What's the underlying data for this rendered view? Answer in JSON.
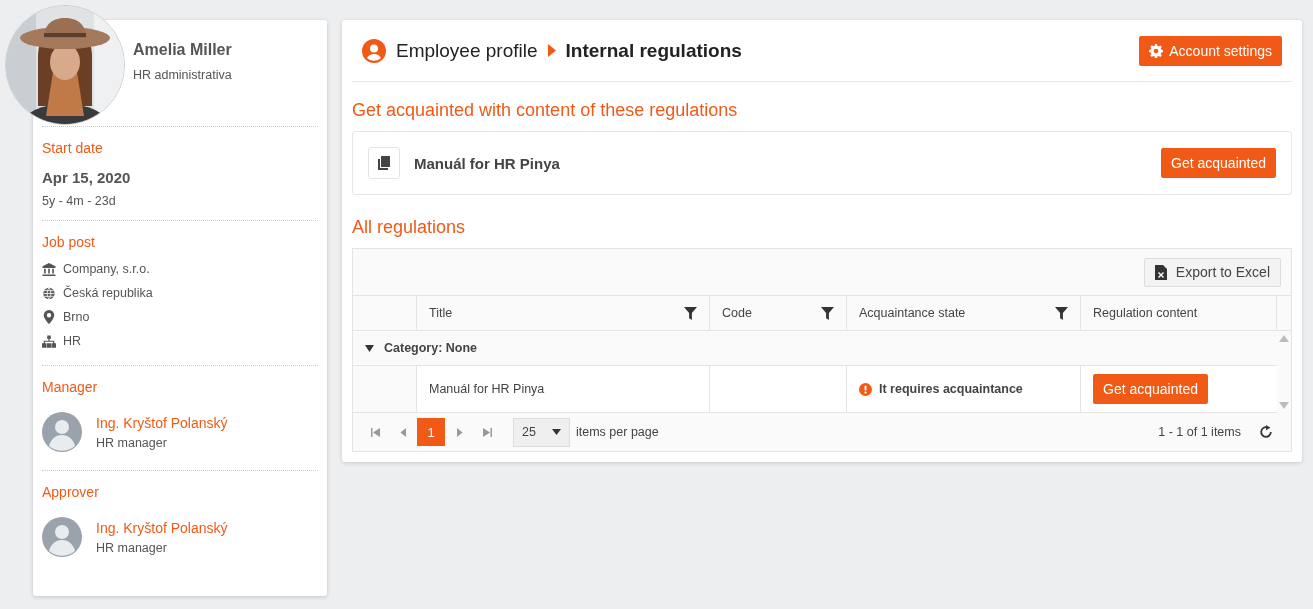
{
  "profile": {
    "name": "Amelia Miller",
    "role": "HR administrativa"
  },
  "sections": [
    {
      "kind": "date",
      "title": "Start date",
      "date": "Apr 15, 2020",
      "duration": "5y - 4m - 23d"
    },
    {
      "kind": "list",
      "title": "Job post",
      "items": [
        {
          "kind": "company",
          "text": "Company, s.r.o."
        },
        {
          "kind": "country",
          "text": "Česká republika"
        },
        {
          "kind": "city",
          "text": "Brno"
        },
        {
          "kind": "department",
          "text": "HR"
        }
      ]
    },
    {
      "kind": "person",
      "title": "Manager",
      "name": "Ing. Kryštof Polanský",
      "role": "HR manager"
    },
    {
      "kind": "person",
      "title": "Approver",
      "name": "Ing. Kryštof Polanský",
      "role": "HR manager"
    }
  ],
  "breadcrumb": [
    "Employee profile",
    "Internal regulations"
  ],
  "account_button": "Account settings",
  "pending": {
    "title": "Get acquainted with content of these regulations",
    "items": [
      {
        "title": "Manuál for HR Pinya",
        "button": "Get acquainted"
      }
    ]
  },
  "regulations": {
    "title": "All regulations",
    "export_button": "Export to Excel",
    "columns": [
      {
        "label": "Title",
        "filterable": true
      },
      {
        "label": "Code",
        "filterable": true
      },
      {
        "label": "Acquaintance state",
        "filterable": true
      },
      {
        "label": "Regulation content",
        "filterable": false
      }
    ],
    "groups": [
      {
        "label": "Category: None",
        "expanded": true,
        "rows": [
          {
            "title": "Manuál for HR Pinya",
            "state": {
              "kind": "required",
              "text": "It requires acquaintance"
            },
            "button": "Get acquainted"
          }
        ]
      }
    ],
    "pager": {
      "pages": [
        {
          "label": "1",
          "selected": true
        }
      ],
      "page_size": "25",
      "per_page_label": "items per page",
      "summary": "1 - 1 of 1 items"
    }
  }
}
